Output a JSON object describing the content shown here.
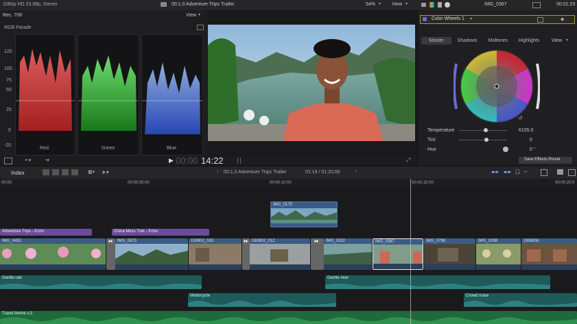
{
  "topbar": {
    "format": "1080p HD 23.98p, Stereo",
    "project_title": "00:1.0 Adventure Trips Trailer",
    "zoom": "54%",
    "view_label": "View",
    "clip_name": "IMG_0367",
    "timecode": "00:01:23"
  },
  "scopes": {
    "rec_label": "Rec. 709",
    "view_label": "View",
    "parade_label": "RGB Parade",
    "y_ticks": [
      "120",
      "100",
      "75",
      "50",
      "25",
      "0",
      "-20"
    ],
    "channels": [
      "Red",
      "Green",
      "Blue"
    ]
  },
  "inspector": {
    "effect_name": "Color Wheels 1",
    "tabs": [
      "Master",
      "Shadows",
      "Midtones",
      "Highlights"
    ],
    "view_label": "View",
    "params": [
      {
        "label": "Temperature",
        "value": "6155.0"
      },
      {
        "label": "Tint",
        "value": "0"
      },
      {
        "label": "Hue",
        "value": "0 °"
      }
    ],
    "save_preset": "Save Effects Preset",
    "colors": {
      "accent": "#6f6ad8",
      "panel": "#1f1f21"
    }
  },
  "transport": {
    "timecode_dim": "00:00",
    "timecode": "14:22"
  },
  "timeline": {
    "index_label": "Index",
    "project_title": "00:1.0 Adventure Trips Trailer",
    "duration": "01:19 / 01:20:06",
    "ruler": [
      "00:00",
      "00:00:05:00",
      "00:00:10:00",
      "00:00:15:00",
      "00:00:20:0"
    ],
    "connected_clip": "IMG_0175",
    "titles": [
      "Adventure Trips - Echo",
      "China Mess Trek - Echo"
    ],
    "clips": [
      "IMG_0452",
      "IMG_0873",
      "150802_020",
      "160802_012",
      "IMG_0322",
      "IMG_0367",
      "IMG_0798",
      "IMG_0298",
      "160803c"
    ],
    "audio": [
      "Gentle rain",
      "Gentle river",
      "Motorcycle",
      "Crowd noise",
      "Travel theme v.3"
    ]
  }
}
